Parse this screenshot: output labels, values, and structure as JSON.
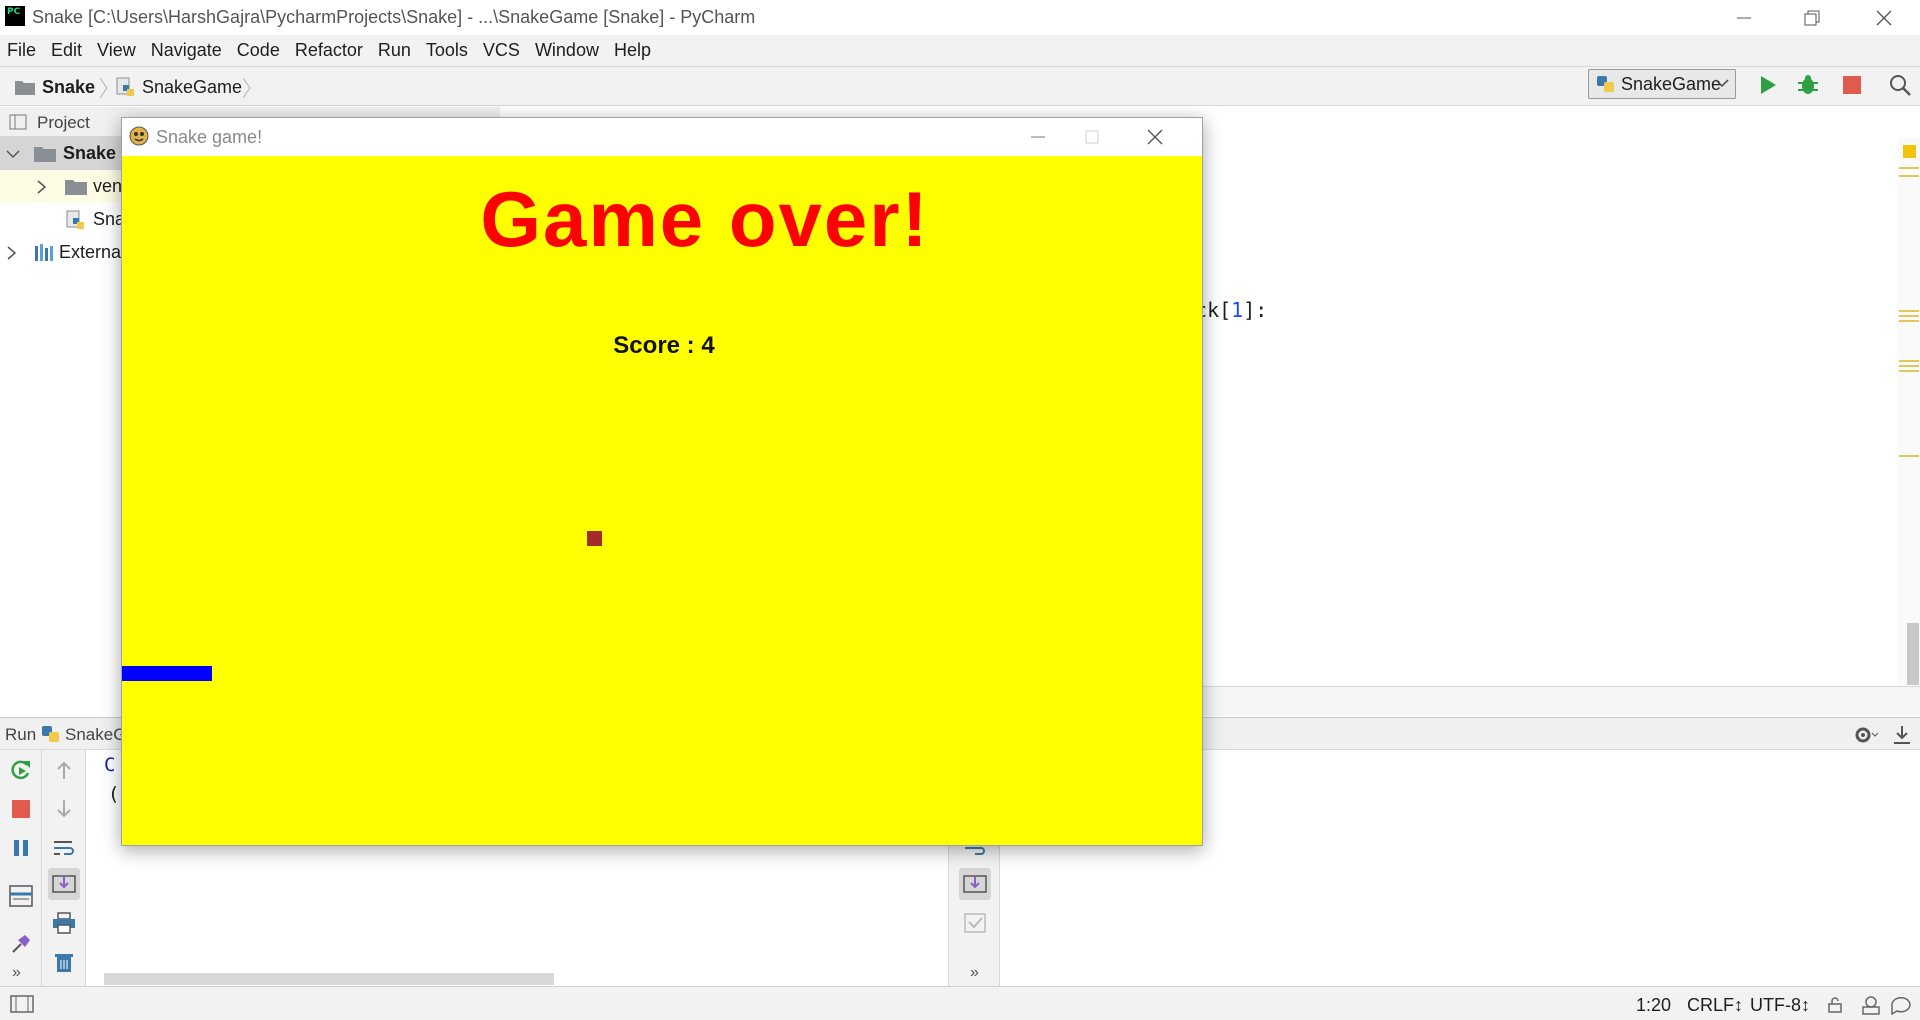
{
  "window": {
    "title": "Snake [C:\\Users\\HarshGajra\\PycharmProjects\\Snake] - ...\\SnakeGame [Snake] - PyCharm",
    "app_icon_text": "PC"
  },
  "menu": [
    "File",
    "Edit",
    "View",
    "Navigate",
    "Code",
    "Refactor",
    "Run",
    "Tools",
    "VCS",
    "Window",
    "Help"
  ],
  "breadcrumb": {
    "project": "Snake",
    "file": "SnakeGame"
  },
  "run_config": {
    "selected": "SnakeGame"
  },
  "project_panel": {
    "title": "Project",
    "tree": [
      {
        "label": "Snake",
        "bold": true
      },
      {
        "label": "ven"
      },
      {
        "label": "Sna"
      },
      {
        "label": "External"
      }
    ]
  },
  "editor": {
    "visible_code": {
      "prefix": "ock[",
      "num": "1",
      "suffix": "]:"
    }
  },
  "run_panel": {
    "label": "Run",
    "config": "SnakeGa",
    "console_lines": [
      "C",
      "(-"
    ]
  },
  "status": {
    "position": "1:20",
    "line_sep": "CRLF↕",
    "encoding": "UTF-8↕"
  },
  "game": {
    "title": "Snake game!",
    "game_over_text": "Game over!",
    "score_text": "Score : 4",
    "colors": {
      "background": "#ffff00",
      "game_over": "#ff0000",
      "food": "#a52a2a",
      "snake": "#0000ff"
    }
  }
}
